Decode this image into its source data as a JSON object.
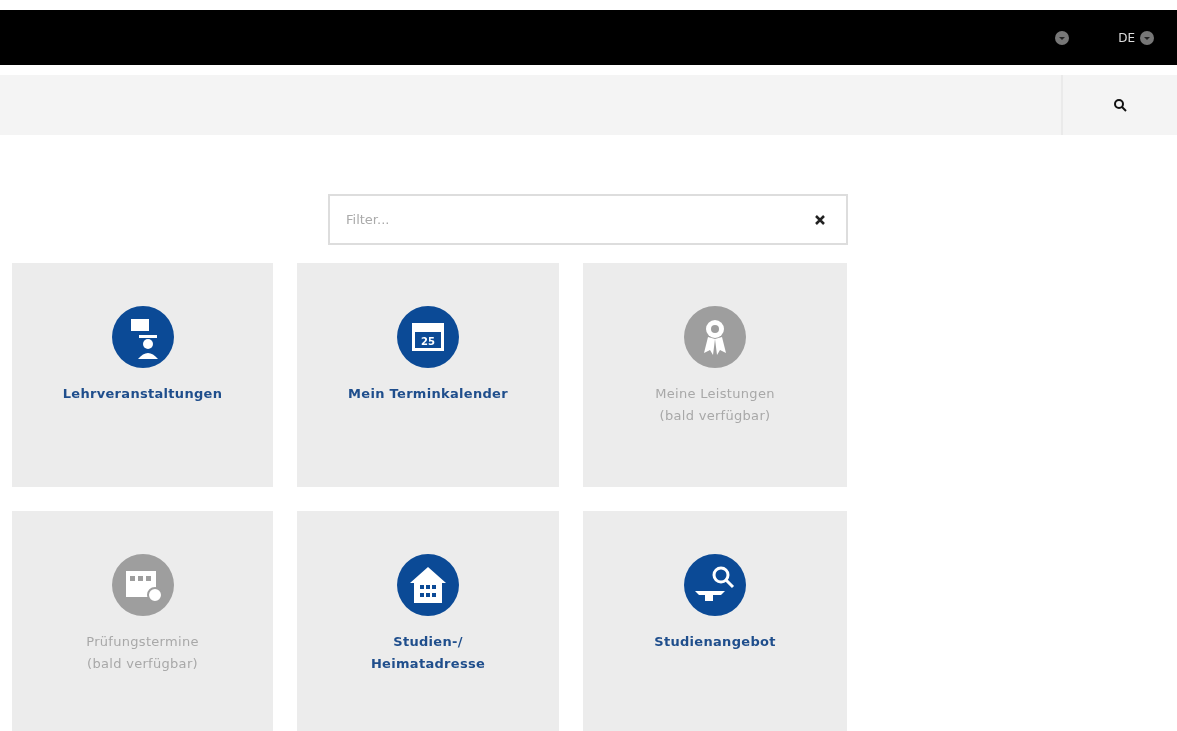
{
  "top_bar": {
    "language": "DE"
  },
  "filter": {
    "placeholder": "Filter..."
  },
  "tiles": [
    {
      "label": "Lehrveranstaltungen",
      "kind": "lecture",
      "disabled": false
    },
    {
      "label": "Mein Terminkalender",
      "kind": "calendar",
      "day": "25",
      "disabled": false
    },
    {
      "label": "Meine Leistungen\n(bald verfügbar)",
      "kind": "award",
      "disabled": true
    },
    {
      "label": "Prüfungstermine\n(bald verfügbar)",
      "kind": "exams",
      "disabled": true
    },
    {
      "label": "Studien-/\nHeimatadresse",
      "kind": "house",
      "disabled": false
    },
    {
      "label": "Studienangebot",
      "kind": "study",
      "disabled": false
    }
  ]
}
